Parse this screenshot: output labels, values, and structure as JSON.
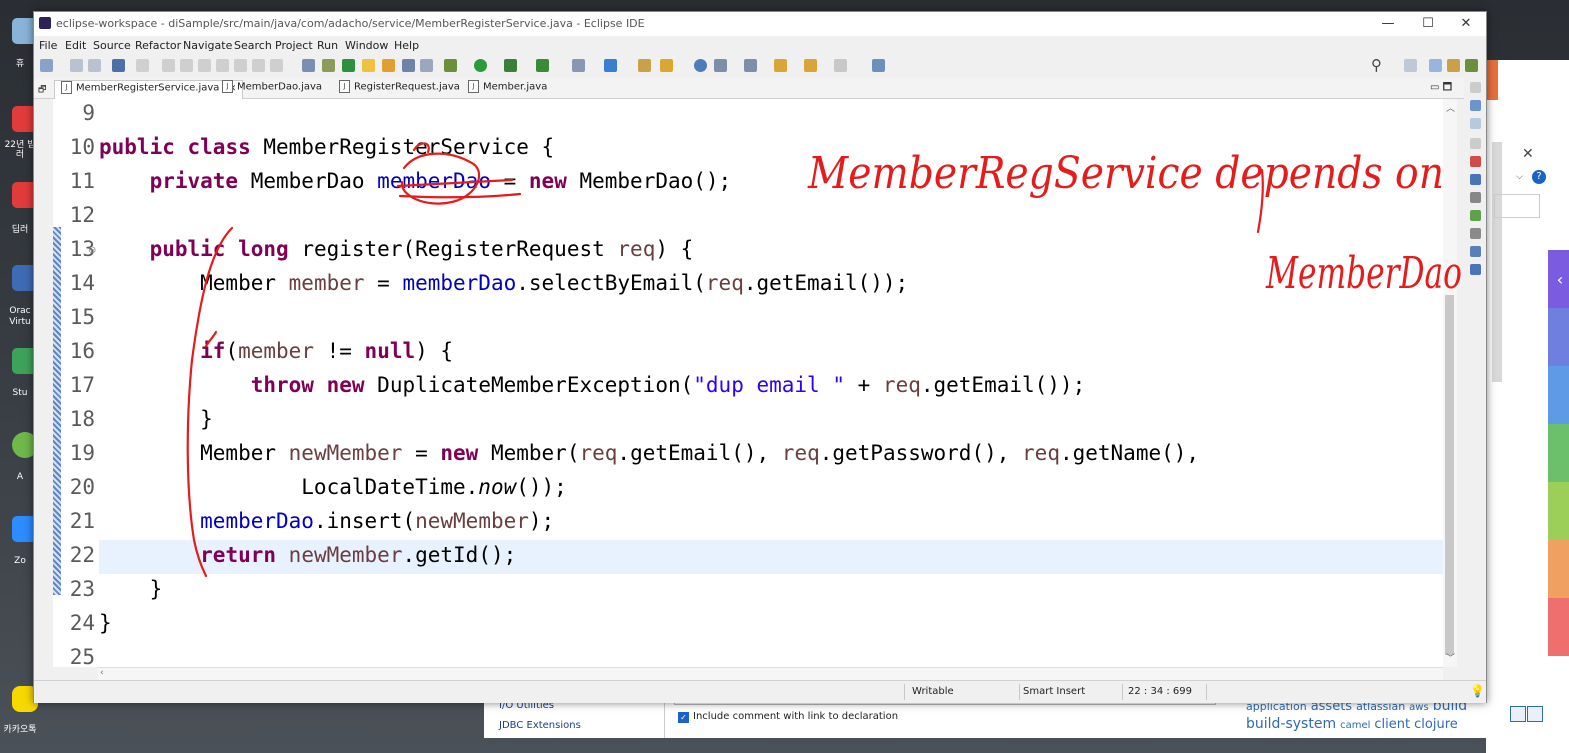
{
  "colors": {
    "keyword": "#7f0055",
    "field": "#0000c0",
    "local": "#6a3e3e",
    "string": "#2a00ff",
    "annotation_ink": "#e41c1c",
    "current_line": "#e8f2fe"
  },
  "desktop": {
    "labels": [
      "휴",
      "22년 빔러",
      "딥러",
      "Orac Virtu",
      "Stu",
      "A",
      "Zo",
      "카카오톡"
    ]
  },
  "window": {
    "title": "eclipse-workspace - diSample/src/main/java/com/adacho/service/MemberRegisterService.java - Eclipse IDE",
    "minimize": "—",
    "maximize": "☐",
    "close": "✕"
  },
  "menu": [
    "File",
    "Edit",
    "Source",
    "Refactor",
    "Navigate",
    "Search",
    "Project",
    "Run",
    "Window",
    "Help"
  ],
  "tabs": [
    {
      "label": "MemberRegisterService.java",
      "close": "✕"
    },
    {
      "label": "MemberDao.java"
    },
    {
      "label": "RegisterRequest.java"
    },
    {
      "label": "Member.java"
    }
  ],
  "tab_icon_letter": "J",
  "editor": {
    "line_numbers": [
      "9",
      "10",
      "11",
      "12",
      "13",
      "14",
      "15",
      "16",
      "17",
      "18",
      "19",
      "20",
      "21",
      "22",
      "23",
      "24",
      "25"
    ],
    "lines": [
      [],
      [
        {
          "t": "kw",
          "v": "public"
        },
        {
          "t": "p",
          "v": " "
        },
        {
          "t": "kw",
          "v": "class"
        },
        {
          "t": "p",
          "v": " MemberRegisterService {"
        }
      ],
      [
        {
          "t": "p",
          "v": "    "
        },
        {
          "t": "kw",
          "v": "private"
        },
        {
          "t": "p",
          "v": " MemberDao "
        },
        {
          "t": "fld",
          "v": "memberDao"
        },
        {
          "t": "p",
          "v": " = "
        },
        {
          "t": "kw",
          "v": "new"
        },
        {
          "t": "p",
          "v": " MemberDao();"
        }
      ],
      [],
      [
        {
          "t": "p",
          "v": "    "
        },
        {
          "t": "kw",
          "v": "public"
        },
        {
          "t": "p",
          "v": " "
        },
        {
          "t": "kw",
          "v": "long"
        },
        {
          "t": "p",
          "v": " register(RegisterRequest "
        },
        {
          "t": "loc",
          "v": "req"
        },
        {
          "t": "p",
          "v": ") {"
        }
      ],
      [
        {
          "t": "p",
          "v": "        Member "
        },
        {
          "t": "loc",
          "v": "member"
        },
        {
          "t": "p",
          "v": " = "
        },
        {
          "t": "fld",
          "v": "memberDao"
        },
        {
          "t": "p",
          "v": ".selectByEmail("
        },
        {
          "t": "loc",
          "v": "req"
        },
        {
          "t": "p",
          "v": ".getEmail());"
        }
      ],
      [],
      [
        {
          "t": "p",
          "v": "        "
        },
        {
          "t": "kw",
          "v": "if"
        },
        {
          "t": "p",
          "v": "("
        },
        {
          "t": "loc",
          "v": "member"
        },
        {
          "t": "p",
          "v": " != "
        },
        {
          "t": "kw",
          "v": "null"
        },
        {
          "t": "p",
          "v": ") {"
        }
      ],
      [
        {
          "t": "p",
          "v": "            "
        },
        {
          "t": "kw",
          "v": "throw"
        },
        {
          "t": "p",
          "v": " "
        },
        {
          "t": "kw",
          "v": "new"
        },
        {
          "t": "p",
          "v": " DuplicateMemberException("
        },
        {
          "t": "str",
          "v": "\"dup email \""
        },
        {
          "t": "p",
          "v": " + "
        },
        {
          "t": "loc",
          "v": "req"
        },
        {
          "t": "p",
          "v": ".getEmail());"
        }
      ],
      [
        {
          "t": "p",
          "v": "        }"
        }
      ],
      [
        {
          "t": "p",
          "v": "        Member "
        },
        {
          "t": "loc",
          "v": "newMember"
        },
        {
          "t": "p",
          "v": " = "
        },
        {
          "t": "kw",
          "v": "new"
        },
        {
          "t": "p",
          "v": " Member("
        },
        {
          "t": "loc",
          "v": "req"
        },
        {
          "t": "p",
          "v": ".getEmail(), "
        },
        {
          "t": "loc",
          "v": "req"
        },
        {
          "t": "p",
          "v": ".getPassword(), "
        },
        {
          "t": "loc",
          "v": "req"
        },
        {
          "t": "p",
          "v": ".getName(),"
        }
      ],
      [
        {
          "t": "p",
          "v": "                LocalDateTime."
        },
        {
          "t": "it",
          "v": "now"
        },
        {
          "t": "p",
          "v": "());"
        }
      ],
      [
        {
          "t": "p",
          "v": "        "
        },
        {
          "t": "fld",
          "v": "memberDao"
        },
        {
          "t": "p",
          "v": ".insert("
        },
        {
          "t": "loc",
          "v": "newMember"
        },
        {
          "t": "p",
          "v": ");"
        }
      ],
      [
        {
          "t": "p",
          "v": "        "
        },
        {
          "t": "kw",
          "v": "return"
        },
        {
          "t": "p",
          "v": " "
        },
        {
          "t": "loc",
          "v": "newMember"
        },
        {
          "t": "p",
          "v": ".getId();"
        }
      ],
      [
        {
          "t": "p",
          "v": "    }"
        }
      ],
      [
        {
          "t": "p",
          "v": "}"
        }
      ],
      []
    ],
    "current_line_index": 13
  },
  "annotations": {
    "line1": "MemberRegService depends on",
    "line2": "MemberDao"
  },
  "status": {
    "writable": "Writable",
    "insert_mode": "Smart Insert",
    "position": "22 : 34 : 699"
  },
  "underlying_window": {
    "items": [
      "I/O Utilities",
      "JDBC Extensions"
    ],
    "checkbox_label": "Include comment with link to declaration",
    "tags": [
      "application",
      "assets",
      "atlassian",
      "aws",
      "build",
      "build-system",
      "camel",
      "client",
      "clojure"
    ]
  },
  "bg_window": {
    "close": "✕",
    "help": "?",
    "chevron": "⌵",
    "side_tab_arrow": "‹"
  }
}
